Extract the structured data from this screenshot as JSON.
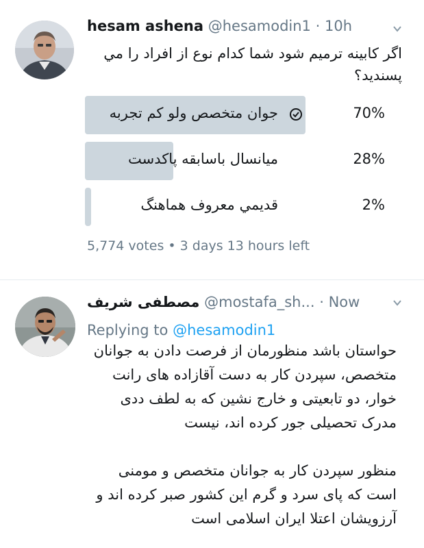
{
  "tweet1": {
    "name": "hesam ashena",
    "handle": "@hesamodin1",
    "separator": "·",
    "time": "10h",
    "question": "اگر کابینه ترمیم شود شما کدام نوع از افراد را مي پسندید؟",
    "poll": {
      "options": [
        {
          "label": "جوان متخصص ولو کم تجربه",
          "percent": "70%",
          "fraction": 0.7,
          "selected": true
        },
        {
          "label": "میانسال باسابقه پاکدست",
          "percent": "28%",
          "fraction": 0.28,
          "selected": false
        },
        {
          "label": "قديمي معروف هماهنگ",
          "percent": "2%",
          "fraction": 0.02,
          "selected": false
        }
      ],
      "votes": "5,774 votes",
      "separator": "•",
      "time_left": "3 days 13 hours left"
    }
  },
  "tweet2": {
    "name": "مصطفی شریف",
    "handle": "@mostafa_sh...",
    "separator": "·",
    "time": "Now",
    "replying_prefix": "Replying to",
    "replying_to": "@hesamodin1",
    "paragraph1": "حواستان باشد منظورمان از فرصت دادن به جوانان متخصص، سپردن کار به دست آقازاده های رانت خوار، دو تابعیتی و خارج نشین که به لطف ددی مدرک تحصیلی جور کرده اند، نیست",
    "paragraph2": "منظور سپردن کار به جوانان متخصص و مومنی است که پای سرد و گرم این کشور صبر کرده اند و آرزویشان اعتلا ایران اسلامی است"
  },
  "icons": {
    "chevron": "chevron-down-icon",
    "check": "check-circle-icon"
  },
  "colors": {
    "poll_bar": "#ccd6dd",
    "link": "#1da1f2",
    "muted": "#657786"
  }
}
